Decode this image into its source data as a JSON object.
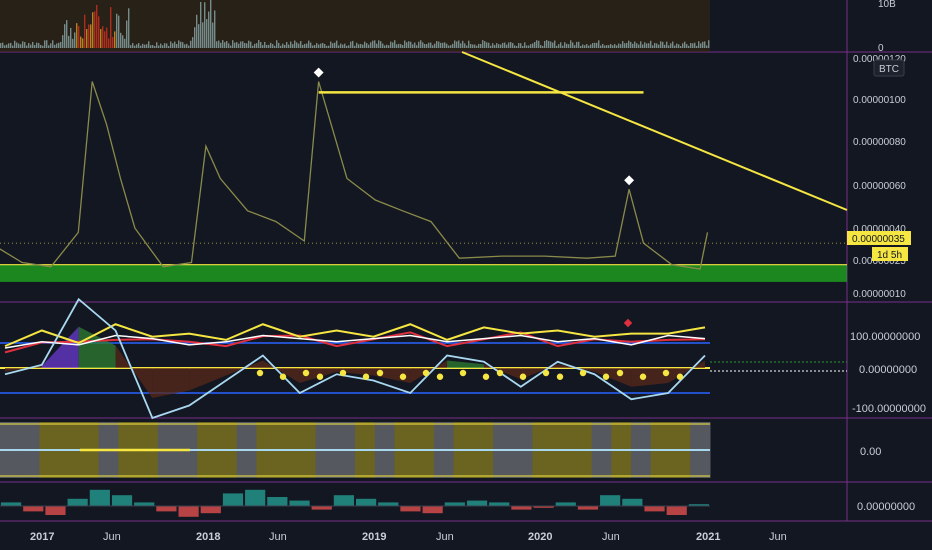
{
  "colors": {
    "background": "#131722",
    "divider": "#7a2f8a",
    "grid": "#1e222d",
    "axis_text": "#c9cdd6",
    "price_line": "#8a8a4a",
    "yellow": "#f5e642",
    "green_zone": "#1e9b1e",
    "white": "#ffffff",
    "red": "#e03040",
    "blue": "#2962ff",
    "light_blue": "#a8d8f0",
    "osc_green": "#2e7d32",
    "osc_purple": "#6a3bd1",
    "osc_brown": "#5a2a1a",
    "hist_green": "#26a69a",
    "hist_red": "#ef5350",
    "volume": "#8fb0b0"
  },
  "volume_panel": {
    "axis_labels": [
      "10B",
      "0"
    ],
    "label_values": [
      10,
      0
    ]
  },
  "price_panel": {
    "currency_badge": "BTC",
    "axis_labels": [
      "0.00000120",
      "0.00000100",
      "0.00000080",
      "0.00000060",
      "0.00000040",
      "0.00000025",
      "0.00000010"
    ],
    "label_values": [
      1.2e-06,
      1e-06,
      8e-07,
      6e-07,
      4e-07,
      2.5e-07,
      1e-07
    ],
    "last_price_tag": "0.00000035",
    "countdown_tag": "1d 5h"
  },
  "oscillator_panel": {
    "axis_labels": [
      "100.00000000",
      "0.00000000",
      "-100.00000000"
    ],
    "label_values": [
      100,
      0,
      -100
    ]
  },
  "regime_panel": {
    "axis_labels": [
      "0.00"
    ]
  },
  "histogram_panel": {
    "axis_labels": [
      "0.00000000"
    ]
  },
  "time_axis": {
    "labels": [
      "2017",
      "Jun",
      "2018",
      "Jun",
      "2019",
      "Jun",
      "2020",
      "Jun",
      "2021",
      "Jun"
    ],
    "bold": [
      true,
      false,
      true,
      false,
      true,
      false,
      true,
      false,
      true,
      false
    ]
  },
  "chart_data": [
    {
      "type": "line",
      "panel": "price",
      "symbol_currency": "BTC",
      "x": [
        "2016-10",
        "2016-12",
        "2017-02",
        "2017-04",
        "2017-05",
        "2017-06",
        "2017-07",
        "2017-08",
        "2017-10",
        "2017-12",
        "2018-01",
        "2018-02",
        "2018-04",
        "2018-06",
        "2018-08",
        "2018-09",
        "2018-11",
        "2019-01",
        "2019-03",
        "2019-05",
        "2019-07",
        "2019-10",
        "2020-01",
        "2020-04",
        "2020-06",
        "2020-07",
        "2020-08",
        "2020-10",
        "2020-12",
        "2020-12-31"
      ],
      "y": [
        3.4e-07,
        2.6e-07,
        2.4e-07,
        4e-07,
        1.1e-06,
        9e-07,
        6.5e-07,
        4.2e-07,
        2.4e-07,
        2.6e-07,
        8e-07,
        6.5e-07,
        5e-07,
        4.5e-07,
        3.6e-07,
        1.1e-06,
        6.5e-07,
        5.5e-07,
        5e-07,
        4.5e-07,
        2.8e-07,
        2.9e-07,
        2.9e-07,
        2.8e-07,
        2.9e-07,
        6e-07,
        3.5e-07,
        2.5e-07,
        2.3e-07,
        4e-07
      ],
      "horizontal_levels": [
        1.05e-06,
        2.5e-07
      ],
      "support_zone": [
        1.7e-07,
        2.5e-07
      ],
      "ylim": [
        7e-08,
        1.25e-06
      ]
    },
    {
      "type": "area",
      "panel": "oscillator",
      "series": [
        {
          "values": [
            40,
            50,
            45,
            60,
            55,
            45,
            50,
            60,
            55,
            50,
            55,
            60,
            50,
            55,
            60,
            50,
            55,
            45,
            60,
            55
          ]
        },
        {
          "values": [
            -10,
            5,
            110,
            60,
            -80,
            -60,
            -20,
            20,
            -40,
            -10,
            -20,
            -40,
            20,
            10,
            -30,
            10,
            -10,
            -50,
            -40,
            20
          ]
        }
      ],
      "levels": [
        100,
        40,
        0,
        -40
      ],
      "ylim": [
        -120,
        130
      ]
    },
    {
      "type": "heatmap",
      "panel": "regime",
      "values": [
        0,
        0,
        1,
        1,
        1,
        0,
        1,
        1,
        0,
        0,
        1,
        1,
        0,
        1,
        1,
        1,
        0,
        0,
        1,
        0,
        1,
        1,
        0,
        1,
        1,
        0,
        0,
        1,
        1,
        1,
        0,
        1,
        0,
        1,
        1,
        0
      ]
    },
    {
      "type": "bar",
      "panel": "histogram",
      "values": [
        0.2,
        -0.3,
        -0.5,
        0.4,
        0.9,
        0.6,
        0.2,
        -0.3,
        -0.6,
        -0.4,
        0.7,
        0.9,
        0.5,
        0.3,
        -0.2,
        0.6,
        0.4,
        0.2,
        -0.3,
        -0.4,
        0.2,
        0.3,
        0.2,
        -0.2,
        -0.1,
        0.2,
        -0.2,
        0.6,
        0.4,
        -0.3,
        -0.5,
        0.1
      ]
    }
  ]
}
